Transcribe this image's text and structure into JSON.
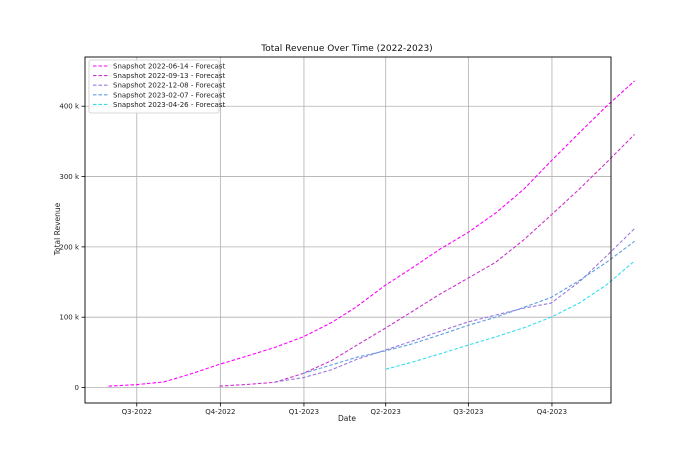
{
  "chart_data": {
    "type": "line",
    "title": "Total Revenue Over Time (2022-2023)",
    "xlabel": "Date",
    "ylabel": "Total Revenue",
    "xlim": [
      "2022-05-05",
      "2023-12-05"
    ],
    "ylim": [
      -22000,
      470000
    ],
    "grid": true,
    "legend_position": "top-left",
    "x_ticks": [
      {
        "date": "2022-07-01",
        "label": "Q3-2022"
      },
      {
        "date": "2022-10-01",
        "label": "Q4-2022"
      },
      {
        "date": "2023-01-01",
        "label": "Q1-2023"
      },
      {
        "date": "2023-04-01",
        "label": "Q2-2023"
      },
      {
        "date": "2023-07-01",
        "label": "Q3-2023"
      },
      {
        "date": "2023-10-01",
        "label": "Q4-2023"
      }
    ],
    "y_ticks": [
      {
        "value": 0,
        "label": "0"
      },
      {
        "value": 100000,
        "label": "100 k"
      },
      {
        "value": 200000,
        "label": "200 k"
      },
      {
        "value": 300000,
        "label": "300 k"
      },
      {
        "value": 400000,
        "label": "400 k"
      }
    ],
    "series": [
      {
        "name": "Snapshot 2022-06-14 - Forecast",
        "color": "#ff00ff",
        "style": "dashed",
        "points": [
          [
            "2022-05-31",
            2000
          ],
          [
            "2022-06-30",
            4000
          ],
          [
            "2022-07-31",
            8000
          ],
          [
            "2022-08-31",
            20000
          ],
          [
            "2022-09-30",
            33000
          ],
          [
            "2022-10-31",
            45000
          ],
          [
            "2022-11-30",
            57000
          ],
          [
            "2022-12-31",
            72000
          ],
          [
            "2023-01-31",
            92000
          ],
          [
            "2023-02-28",
            115000
          ],
          [
            "2023-03-31",
            145000
          ],
          [
            "2023-04-30",
            170000
          ],
          [
            "2023-05-31",
            197000
          ],
          [
            "2023-06-30",
            220000
          ],
          [
            "2023-07-31",
            248000
          ],
          [
            "2023-08-31",
            282000
          ],
          [
            "2023-09-30",
            322000
          ],
          [
            "2023-10-31",
            362000
          ],
          [
            "2023-11-30",
            400000
          ],
          [
            "2023-12-31",
            436000
          ]
        ]
      },
      {
        "name": "Snapshot 2022-09-13 - Forecast",
        "color": "#cc33cc",
        "style": "dashed",
        "points": [
          [
            "2022-09-30",
            2000
          ],
          [
            "2022-10-31",
            4500
          ],
          [
            "2022-11-30",
            7500
          ],
          [
            "2022-12-31",
            20000
          ],
          [
            "2023-01-31",
            38000
          ],
          [
            "2023-02-28",
            60000
          ],
          [
            "2023-03-31",
            84000
          ],
          [
            "2023-04-30",
            108000
          ],
          [
            "2023-05-31",
            133000
          ],
          [
            "2023-06-30",
            155000
          ],
          [
            "2023-07-31",
            178000
          ],
          [
            "2023-08-31",
            210000
          ],
          [
            "2023-09-30",
            245000
          ],
          [
            "2023-10-31",
            282000
          ],
          [
            "2023-11-30",
            320000
          ],
          [
            "2023-12-31",
            360000
          ]
        ]
      },
      {
        "name": "Snapshot 2022-12-08 - Forecast",
        "color": "#9b78e0",
        "style": "dashed",
        "points": [
          [
            "2022-11-30",
            8000
          ],
          [
            "2022-12-31",
            14000
          ],
          [
            "2023-01-31",
            25000
          ],
          [
            "2023-02-28",
            40000
          ],
          [
            "2023-03-31",
            53000
          ],
          [
            "2023-04-30",
            66000
          ],
          [
            "2023-05-31",
            80000
          ],
          [
            "2023-06-30",
            93000
          ],
          [
            "2023-07-31",
            103000
          ],
          [
            "2023-08-31",
            113000
          ],
          [
            "2023-09-30",
            120000
          ],
          [
            "2023-10-31",
            150000
          ],
          [
            "2023-11-30",
            187000
          ],
          [
            "2023-12-31",
            226000
          ]
        ]
      },
      {
        "name": "Snapshot 2023-02-07 - Forecast",
        "color": "#5f9fdf",
        "style": "dashed",
        "points": [
          [
            "2022-12-31",
            20000
          ],
          [
            "2023-01-31",
            32000
          ],
          [
            "2023-02-28",
            43000
          ],
          [
            "2023-03-31",
            52000
          ],
          [
            "2023-04-30",
            62000
          ],
          [
            "2023-05-31",
            75000
          ],
          [
            "2023-06-30",
            88000
          ],
          [
            "2023-07-31",
            100000
          ],
          [
            "2023-08-31",
            114000
          ],
          [
            "2023-09-30",
            128000
          ],
          [
            "2023-10-31",
            152000
          ],
          [
            "2023-11-30",
            178000
          ],
          [
            "2023-12-31",
            208000
          ]
        ]
      },
      {
        "name": "Snapshot 2023-04-26 - Forecast",
        "color": "#33ddee",
        "style": "dashed",
        "points": [
          [
            "2023-04-01",
            26000
          ],
          [
            "2023-04-30",
            36000
          ],
          [
            "2023-05-31",
            48000
          ],
          [
            "2023-06-30",
            60000
          ],
          [
            "2023-07-31",
            72000
          ],
          [
            "2023-08-31",
            85000
          ],
          [
            "2023-09-30",
            100000
          ],
          [
            "2023-10-31",
            120000
          ],
          [
            "2023-11-30",
            146000
          ],
          [
            "2023-12-31",
            180000
          ]
        ]
      }
    ]
  }
}
